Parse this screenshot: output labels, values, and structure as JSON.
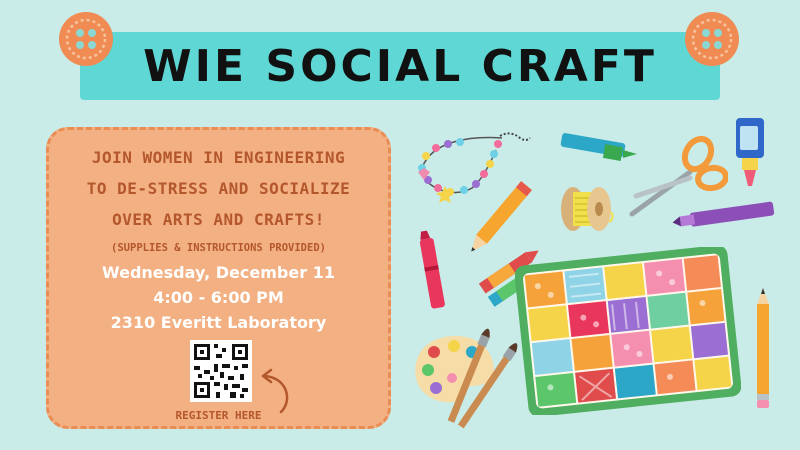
{
  "banner": {
    "title": "WIE SOCIAL CRAFT"
  },
  "panel": {
    "intro_lines": [
      "JOIN WOMEN IN ENGINEERING",
      "TO DE-STRESS AND SOCIALIZE",
      "OVER ARTS AND CRAFTS!"
    ],
    "note": "(SUPPLIES & INSTRUCTIONS PROVIDED)",
    "date": "Wednesday, December 11",
    "time": "4:00 - 6:00 PM",
    "location": "2310 Everitt Laboratory",
    "register_label": "REGISTER HERE"
  },
  "illustrations": {
    "items": [
      "bead-bracelet-icon",
      "marker-icon",
      "scissors-icon",
      "glue-icon",
      "pencil-icon",
      "thread-spool-icon",
      "crayon-icon",
      "paint-palette-icon",
      "paintbrush-icon",
      "quilt-icon"
    ]
  },
  "colors": {
    "background": "#c9ece8",
    "banner": "#5fd7d4",
    "panel": "#f2b083",
    "panel_border": "#e98d55",
    "panel_text": "#b4572c",
    "button": "#f08b54"
  }
}
